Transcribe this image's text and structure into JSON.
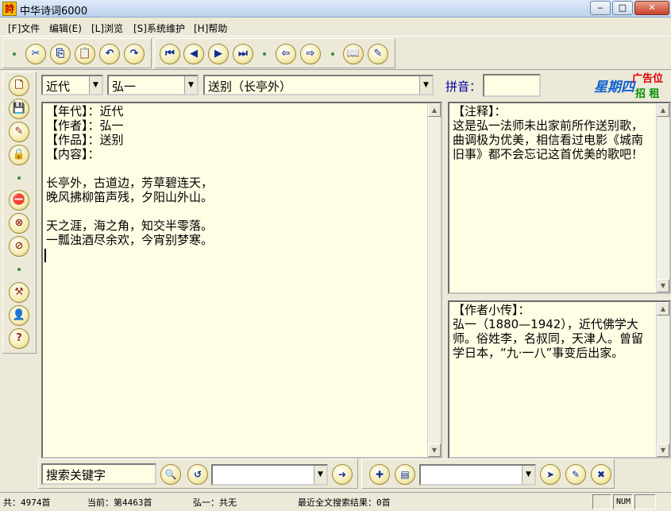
{
  "window": {
    "app_icon_char": "詩",
    "title": "中华诗词6000",
    "minimize": "‒",
    "maximize": "□",
    "close": "✕"
  },
  "menu": [
    "[F]文件",
    "编辑(E)",
    "[L]浏览",
    "[S]系统维护",
    "[H]帮助"
  ],
  "toolbar": {
    "groups": [
      {
        "buttons": [
          {
            "name": "cut-icon",
            "glyph": "✂"
          },
          {
            "name": "copy-icon",
            "glyph": "⎘"
          },
          {
            "name": "paste-icon",
            "glyph": "📋"
          },
          {
            "name": "undo-icon",
            "glyph": "↶"
          },
          {
            "name": "redo-icon",
            "glyph": "↷"
          }
        ]
      },
      {
        "buttons": [
          {
            "name": "first-record-icon",
            "glyph": "⏮"
          },
          {
            "name": "previous-record-icon",
            "glyph": "◀"
          },
          {
            "name": "next-record-icon",
            "glyph": "▶"
          },
          {
            "name": "last-record-icon",
            "glyph": "⏭"
          },
          {
            "name": "back-icon",
            "glyph": "⇦"
          },
          {
            "name": "forward-icon",
            "glyph": "⇨"
          },
          {
            "name": "book-icon",
            "glyph": "📖"
          },
          {
            "name": "edit-pencil-icon",
            "glyph": "✎"
          }
        ]
      }
    ]
  },
  "sidebar": {
    "buttons": [
      {
        "name": "new-document-icon",
        "glyph": "🗋"
      },
      {
        "name": "save-icon",
        "glyph": "💾"
      },
      {
        "name": "clear-icon",
        "glyph": "✎"
      },
      {
        "name": "lock-icon",
        "glyph": "🔒"
      },
      {
        "name": "no-image-icon",
        "glyph": "⛔"
      },
      {
        "name": "no-edit-icon",
        "glyph": "⊗"
      },
      {
        "name": "no-sound-icon",
        "glyph": "⊘"
      },
      {
        "name": "tools-icon",
        "glyph": "⚒"
      },
      {
        "name": "user-icon",
        "glyph": "👤"
      },
      {
        "name": "help-icon",
        "glyph": "?"
      }
    ]
  },
  "selectors": {
    "dynasty": "近代",
    "author": "弘一",
    "poem": "送别（长亭外）"
  },
  "pinyin": {
    "label": "拼音：",
    "value": ""
  },
  "ad": {
    "left": "星期四",
    "right_top": "广告位",
    "right_bottom": "招 租"
  },
  "poem_pane": {
    "text": "【年代】：近代\n【作者】：弘一\n【作品】：送别\n【内容】：\n\n长亭外，古道边，芳草碧连天，\n晚风拂柳笛声残，夕阳山外山。\n\n天之涯，海之角，知交半零落。\n一瓢浊酒尽余欢，今宵别梦寒。"
  },
  "notes_pane": {
    "text": "【注释】：\n这是弘一法师未出家前所作送别歌，曲调极为优美，相信看过电影《城南旧事》都不会忘记这首优美的歌吧！"
  },
  "bio_pane": {
    "text": "【作者小传】：\n弘一（1880—1942），近代佛学大师。俗姓李，名叔同，天津人。曾留学日本，“九·一八”事变后出家。"
  },
  "bottom_bar": {
    "search_placeholder": "搜索关键字",
    "search_value": "搜索关键字",
    "left_buttons": [
      {
        "name": "search-icon",
        "glyph": "🔍"
      },
      {
        "name": "search-history-icon",
        "glyph": "↺"
      },
      {
        "name": "search-go-icon",
        "glyph": "➜"
      }
    ],
    "right_buttons": [
      {
        "name": "add-bookmark-icon",
        "glyph": "✚"
      },
      {
        "name": "open-bookmark-icon",
        "glyph": "▤"
      },
      {
        "name": "bookmark-next-icon",
        "glyph": "➤"
      },
      {
        "name": "bookmark-edit-icon",
        "glyph": "✎"
      },
      {
        "name": "bookmark-delete-icon",
        "glyph": "✖"
      }
    ]
  },
  "status": {
    "total": "共：4974首",
    "current": "当前：第4463首",
    "author_count": "弘一：共无",
    "search_result": "最近全文搜索结果：0首",
    "num": "NUM"
  }
}
